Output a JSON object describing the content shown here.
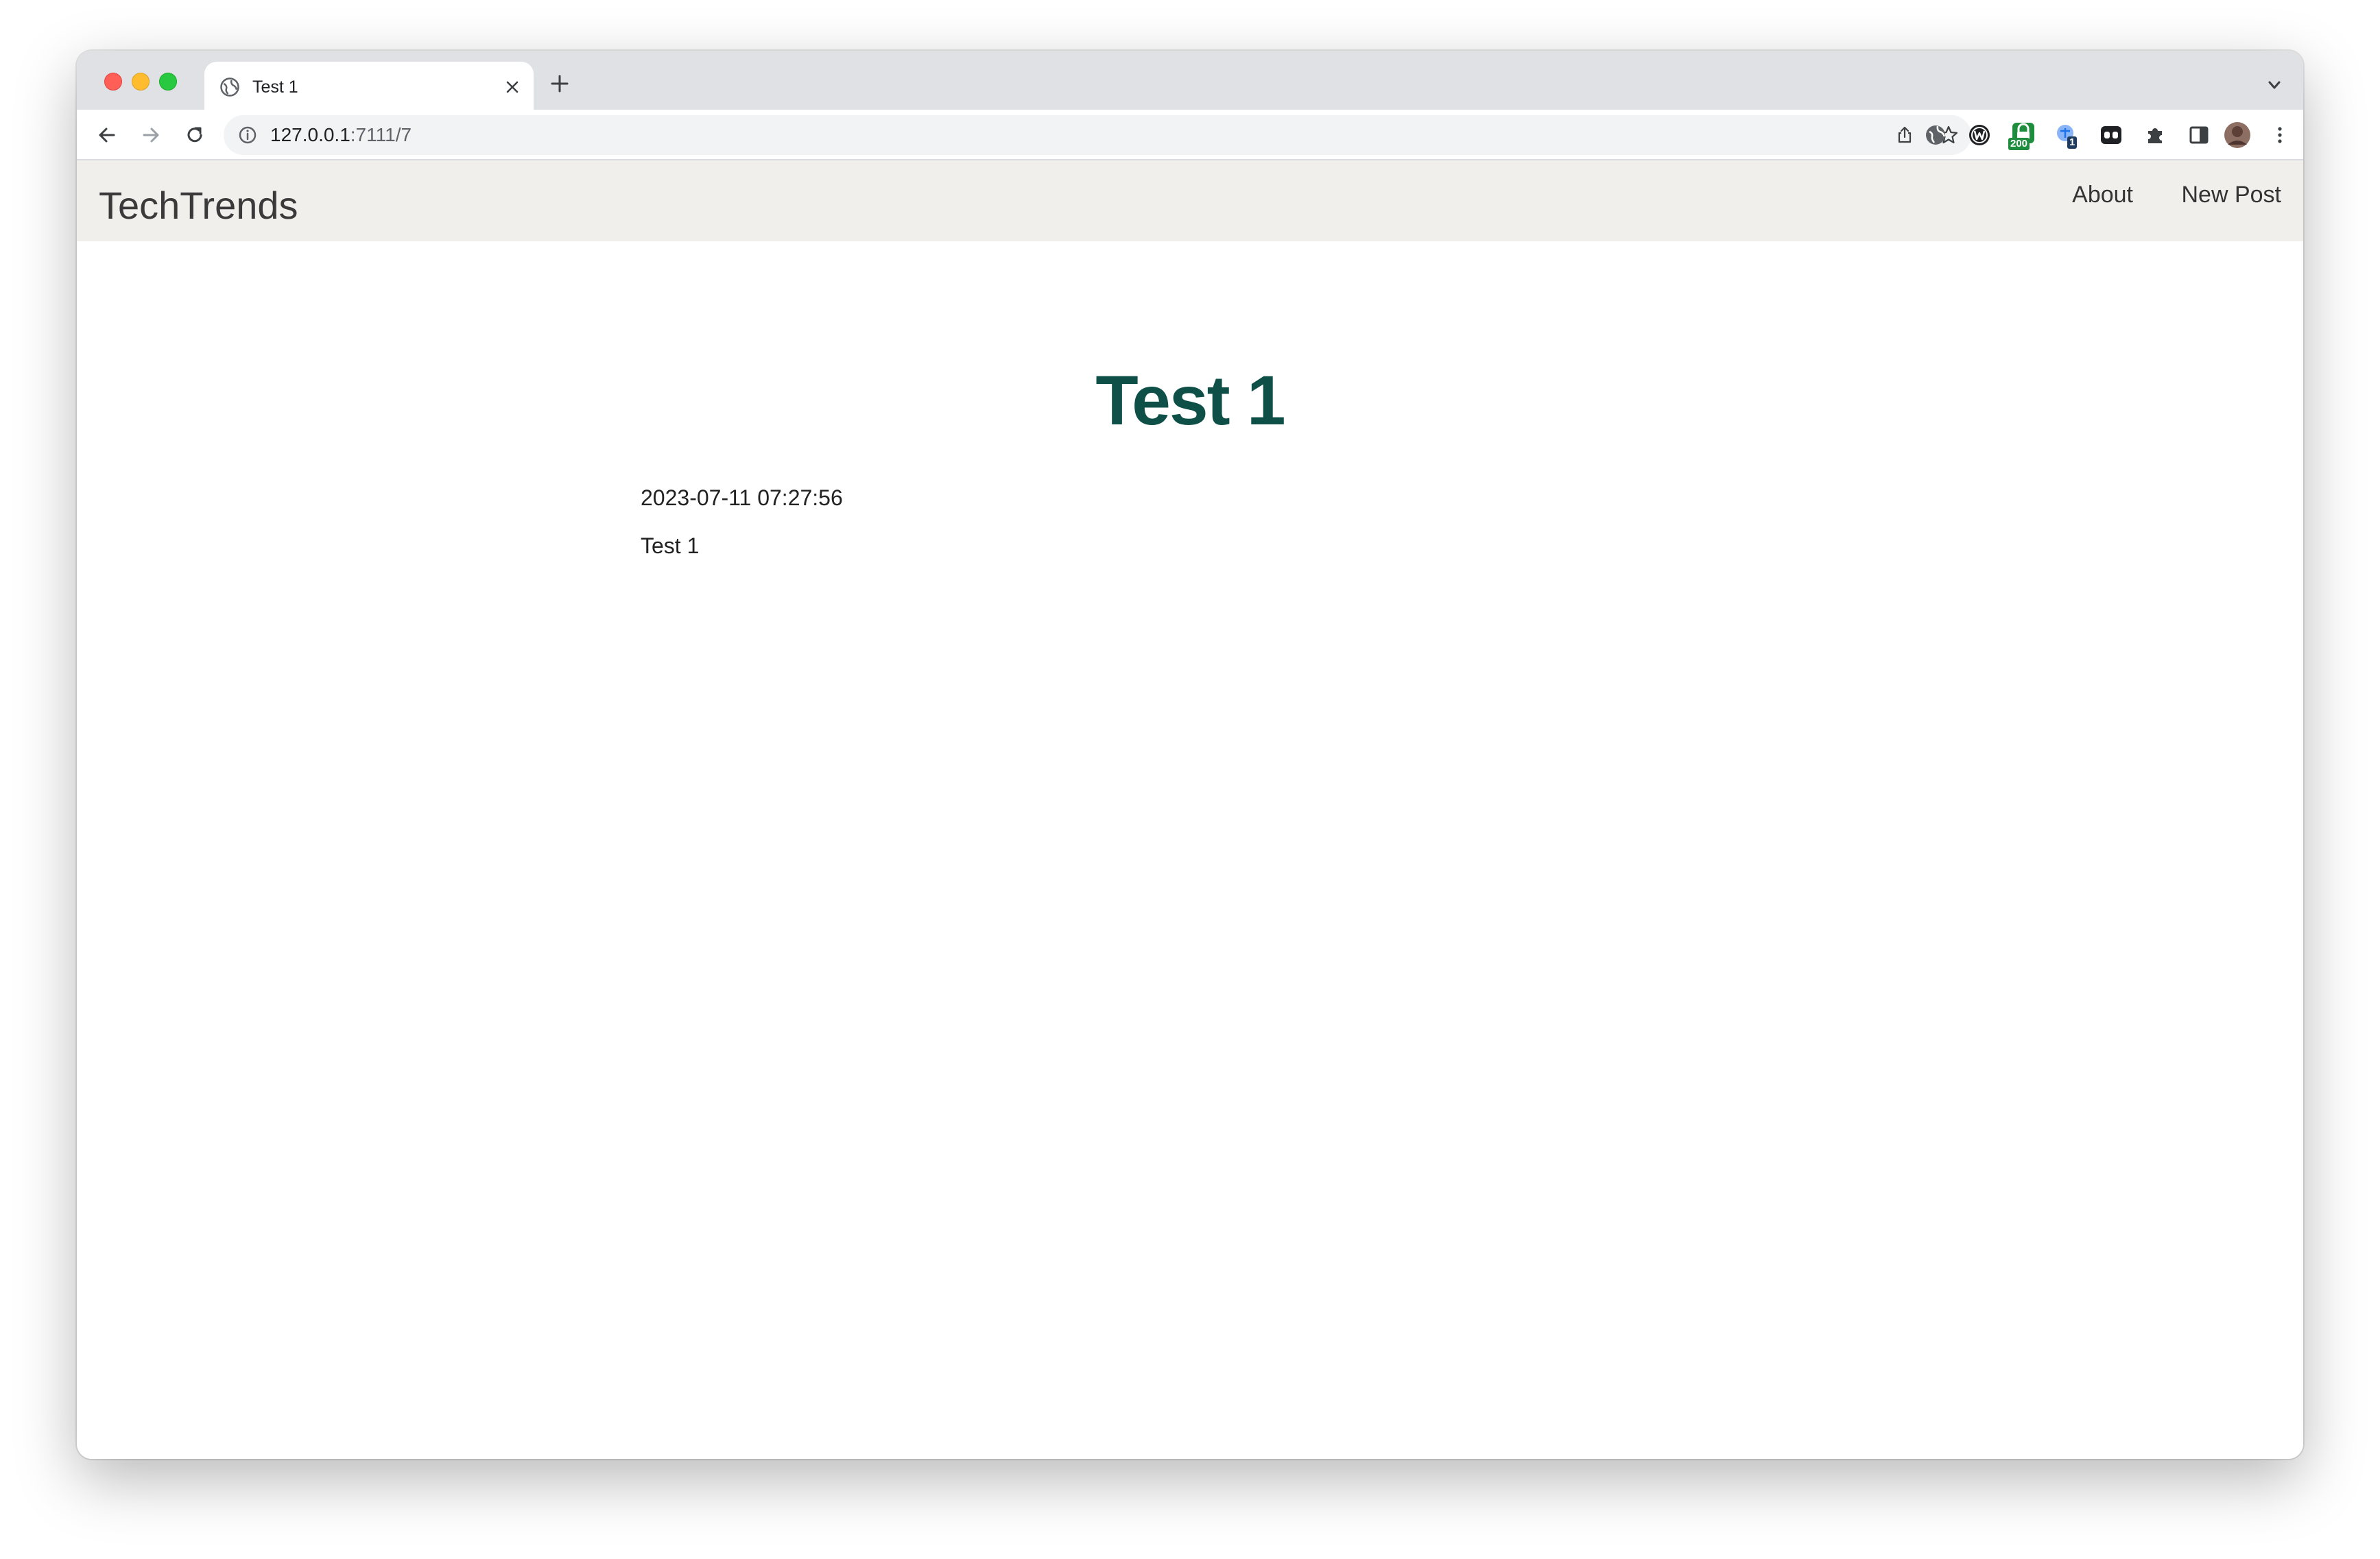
{
  "browser": {
    "tab_title": "Test 1",
    "url_host": "127.0.0.1",
    "url_rest": ":7111/7",
    "extensions": [
      {
        "icon": "globe-extension-icon"
      },
      {
        "icon": "circle-w-extension-icon"
      },
      {
        "icon": "green-lock-extension-icon",
        "badge": "200"
      },
      {
        "icon": "translate-extension-icon",
        "badge": "1"
      },
      {
        "icon": "eyes-extension-icon"
      },
      {
        "icon": "puzzle-icon"
      },
      {
        "icon": "side-panel-icon"
      },
      {
        "icon": "profile-avatar"
      }
    ]
  },
  "site": {
    "brand": "TechTrends",
    "nav": {
      "about": "About",
      "new_post": "New Post"
    }
  },
  "post": {
    "title": "Test 1",
    "created": "2023-07-11 07:27:56",
    "content": "Test 1"
  },
  "colors": {
    "title": "#0e4f48",
    "navbar_bg": "#f0efec",
    "tabstrip_bg": "#dfe1e5"
  }
}
